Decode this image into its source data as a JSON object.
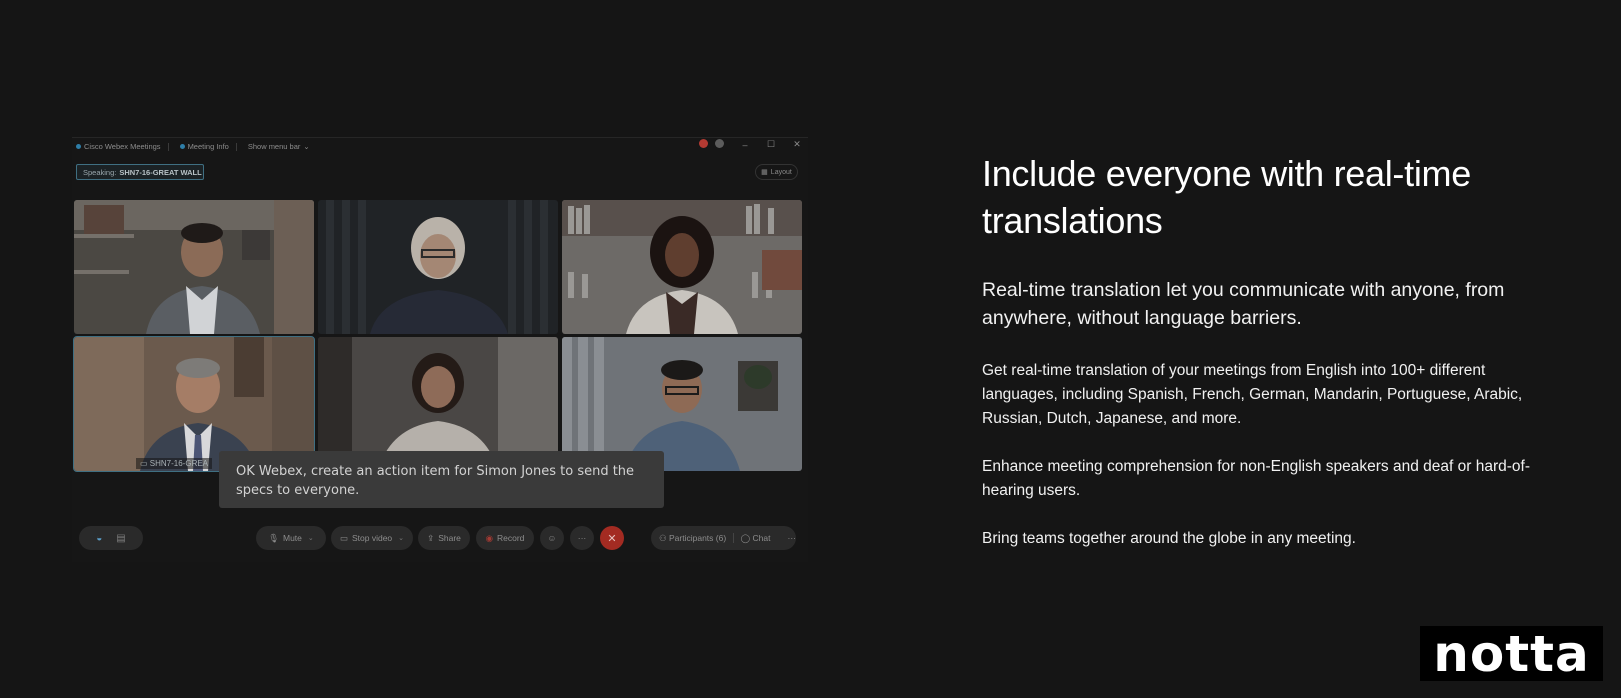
{
  "window": {
    "app_title": "Cisco Webex Meetings",
    "meeting_info": "Meeting Info",
    "show_menu_bar": "Show menu bar",
    "window_buttons": [
      "–",
      "☐",
      "✕"
    ]
  },
  "meeting": {
    "speaking_prefix": "Speaking:",
    "speaking_name": "SHN7-16-GREAT WALL",
    "layout_label": "Layout",
    "active_tile_name": "SHN7-16-GREA",
    "caption_text": "OK Webex, create an action item for Simon Jones to send the specs to everyone."
  },
  "controls": {
    "mute": "Mute",
    "stop_video": "Stop video",
    "share": "Share",
    "record": "Record",
    "participants": "Participants (6)",
    "chat": "Chat",
    "more": "···",
    "end": "✕"
  },
  "copy": {
    "heading": "Include everyone with real-time translations",
    "lead": "Real-time translation let you communicate with anyone, from anywhere, without language barriers.",
    "p1": "Get real-time translation of your meetings from English into 100+ different languages, including Spanish, French, German, Mandarin, Portuguese, Arabic, Russian, Dutch, Japanese, and more.",
    "p2": "Enhance meeting comprehension for non-English speakers and deaf or hard-of-hearing users.",
    "p3": "Bring teams together around the globe in any meeting."
  },
  "brand": {
    "logo_text": "notta"
  },
  "colors": {
    "page_bg": "#151515",
    "accent_border": "#3f6f82",
    "end_call_red": "#a32b22",
    "caption_bg": "#3a3a3a"
  }
}
